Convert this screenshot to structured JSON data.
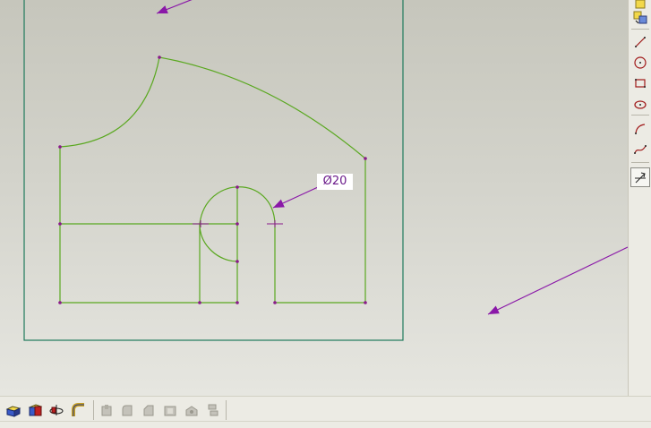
{
  "sketch": {
    "dimension_label": "Ø20"
  },
  "colors": {
    "sketch_line": "#5aa820",
    "vertex": "#8a1a8a",
    "annotation_arrow": "#8a18a8",
    "frame": "#1f7a5c"
  },
  "right_toolbar": {
    "tools": [
      {
        "name": "new-sketch-icon",
        "active": false
      },
      {
        "name": "sketch-properties-icon",
        "active": false
      },
      {
        "name": "line-icon",
        "active": false
      },
      {
        "name": "circle-icon",
        "active": false
      },
      {
        "name": "rectangle-icon",
        "active": false
      },
      {
        "name": "ellipse-icon",
        "active": false
      },
      {
        "name": "arc-icon",
        "active": false
      },
      {
        "name": "spline-icon",
        "active": false
      },
      {
        "name": "trim-icon",
        "active": true
      }
    ]
  },
  "bottom_toolbar": {
    "enabled_tools": [
      "extrude-icon",
      "cut-icon",
      "revolve-icon",
      "sweep-icon"
    ],
    "disabled_tools": [
      "boss-icon",
      "fillet-icon",
      "chamfer-icon",
      "shell-icon",
      "hole-icon",
      "pattern-icon"
    ]
  }
}
